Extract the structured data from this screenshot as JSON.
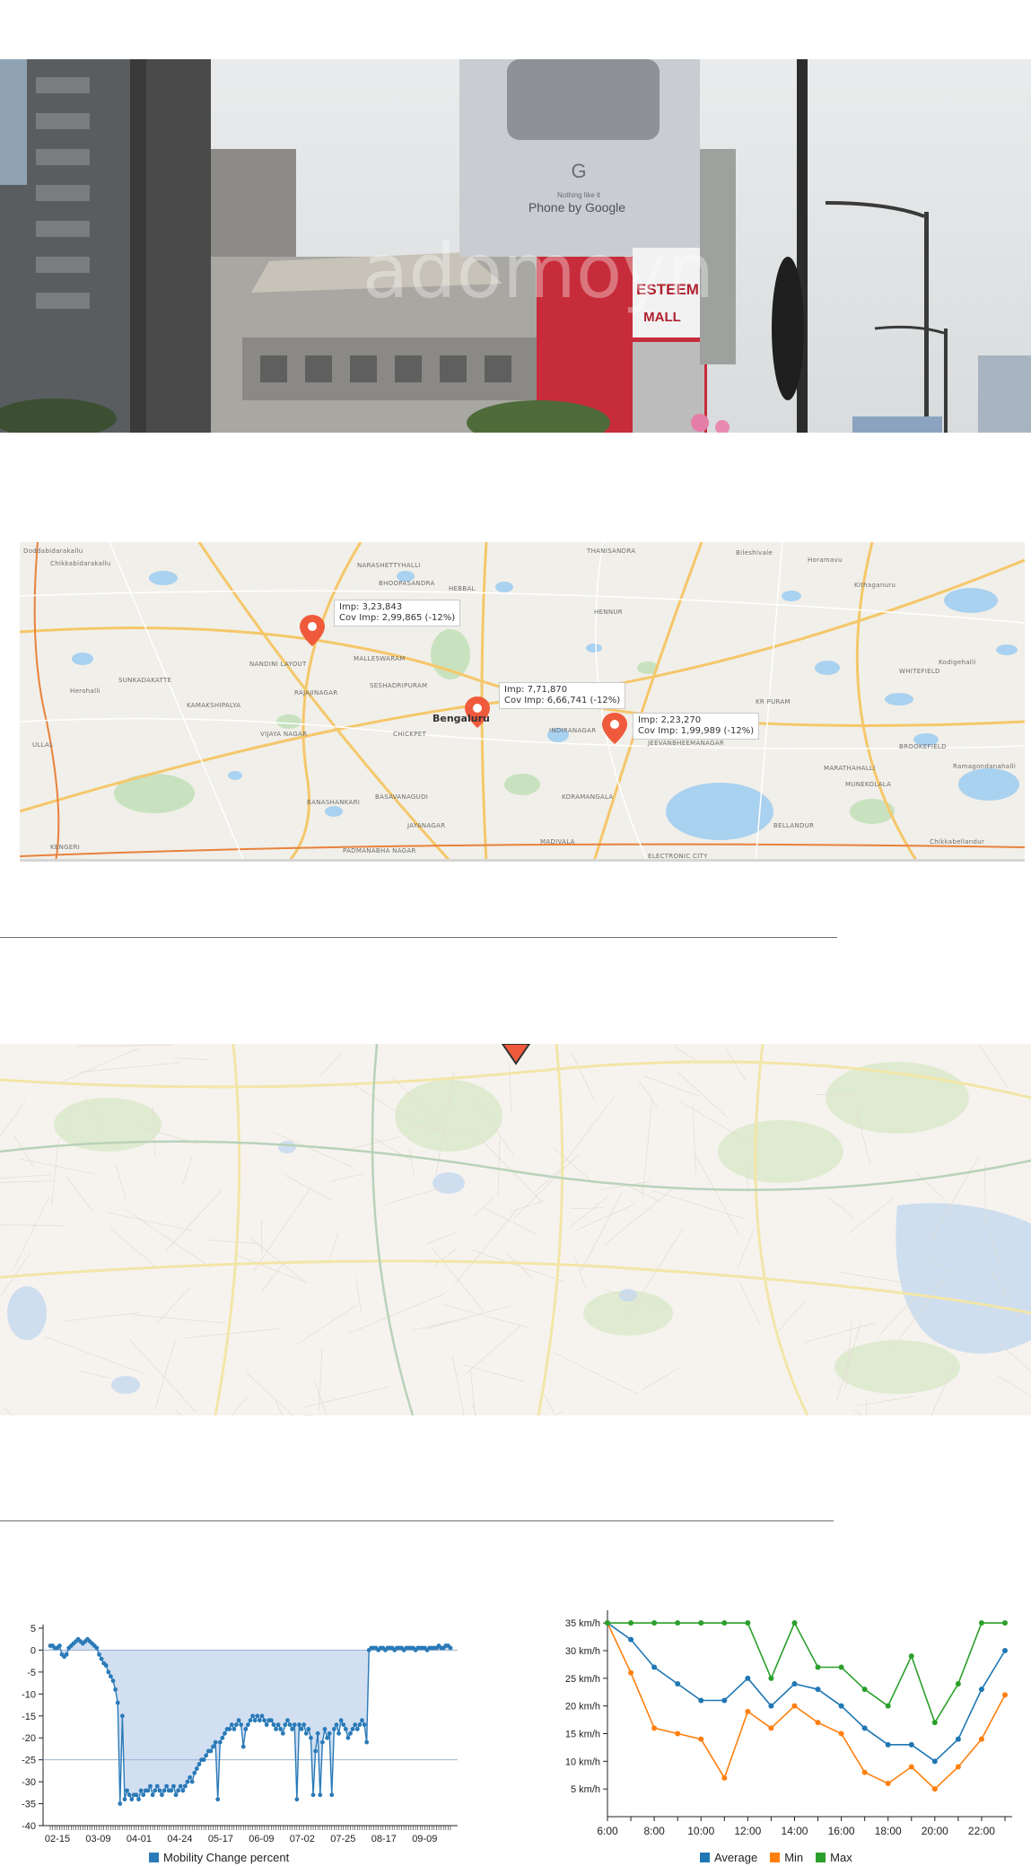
{
  "photo": {
    "billboard_brand": "Phone by Google",
    "billboard_tagline": "Nothing like it",
    "watermark": "adomoyn",
    "mall_sign_line1": "ESTEEM",
    "mall_sign_line2": "MALL"
  },
  "map1": {
    "city_label": "Bengaluru",
    "places": [
      "THANISANDRA",
      "Bileshivale",
      "Doddabidarakallu",
      "Chikkabidarakallu",
      "NARASHETTYHALLI",
      "BHOOPASANDRA",
      "HEBBAL",
      "HENNUR",
      "Horamavu",
      "Kithaganuru",
      "MALLESWARAM",
      "SESHADRIPURAM",
      "VIJAYA NAGAR",
      "CHICKPET",
      "JAYANAGAR",
      "KORAMANGALA",
      "MADIVALA",
      "INDIRANAGAR",
      "JEEVANBHEEMANAGAR",
      "MARATHAHALLI",
      "WHITEFIELD",
      "BROOKEFIELD",
      "KR PURAM",
      "BELLANDUR",
      "BANASHANKARI",
      "PADMANABHA NAGAR",
      "KENGERI",
      "ULLAL",
      "Herohalli",
      "SUNKADAKATTE",
      "NANDINI LAYOUT",
      "KAMAKSHIPALYA",
      "RAJAJINAGAR",
      "BASAVANAGUDI",
      "MUNEKOLALA",
      "Kodigehalli",
      "Ramagondanahalli",
      "Chikkabellandur",
      "ELECTRONIC CITY"
    ],
    "markers": [
      {
        "imp": "Imp: 3,23,843",
        "cov": "Cov Imp: 2,99,865 (-12%)"
      },
      {
        "imp": "Imp: 7,71,870",
        "cov": "Cov Imp: 6,66,741 (-12%)"
      },
      {
        "imp": "Imp: 2,23,270",
        "cov": "Cov Imp: 1,99,989 (-12%)"
      }
    ]
  },
  "charts": {
    "mobility": {
      "partial_title": "",
      "legend_label": "Mobility Change percent",
      "colors": {
        "line": "#2a7ab8",
        "fill": "#c9d9ee",
        "ref": "#9bb3d0"
      }
    },
    "speed": {
      "colors": {
        "Average": "#1f77b4",
        "Min": "#ff7f0e",
        "Max": "#2ca02c"
      }
    }
  },
  "chart_data": [
    {
      "type": "area",
      "title": "",
      "ylim": [
        -40,
        5
      ],
      "yticks": [
        "5",
        "0",
        "-5",
        "-10",
        "-15",
        "-20",
        "-25",
        "-30",
        "-35",
        "-40"
      ],
      "xticks": [
        "02-15",
        "03-09",
        "04-01",
        "04-24",
        "05-17",
        "06-09",
        "07-02",
        "07-25",
        "08-17",
        "09-09"
      ],
      "reference_line": -25,
      "series": [
        {
          "name": "Mobility Change percent",
          "values": [
            1,
            1,
            0.5,
            0.5,
            1,
            -1,
            -1.5,
            -1,
            0.5,
            1,
            1.5,
            2,
            2.5,
            2,
            1.5,
            2,
            2.5,
            2,
            1.5,
            1,
            0.5,
            -1,
            -2,
            -3,
            -3.5,
            -5,
            -6,
            -7,
            -9,
            -12,
            -35,
            -15,
            -34,
            -32,
            -33,
            -34,
            -33,
            -33,
            -34,
            -32,
            -33,
            -32,
            -32,
            -31,
            -33,
            -32,
            -31,
            -32,
            -33,
            -32,
            -31,
            -32,
            -32,
            -31,
            -33,
            -32,
            -31,
            -32,
            -31,
            -30,
            -29,
            -30,
            -28,
            -27,
            -26,
            -25,
            -25,
            -24,
            -23,
            -23,
            -22,
            -21,
            -34,
            -21,
            -20,
            -19,
            -18,
            -18,
            -17,
            -18,
            -17,
            -16,
            -17,
            -22,
            -18,
            -17,
            -16,
            -15,
            -16,
            -15,
            -16,
            -15,
            -16,
            -17,
            -16,
            -16,
            -17,
            -18,
            -17,
            -18,
            -19,
            -17,
            -16,
            -17,
            -18,
            -17,
            -34,
            -17,
            -18,
            -17,
            -19,
            -18,
            -20,
            -33,
            -23,
            -19,
            -33,
            -21,
            -18,
            -20,
            -19,
            -33,
            -18,
            -17,
            -19,
            -16,
            -17,
            -18,
            -20,
            -19,
            -18,
            -17,
            -18,
            -17,
            -16,
            -17,
            -21,
            0,
            0.5,
            0.5,
            0.5,
            0,
            0.5,
            0.5,
            0,
            0.5,
            0.5,
            0.5,
            0,
            0.5,
            0.5,
            0.5,
            0,
            0.5,
            0.5,
            0.5,
            0.5,
            0,
            0.5,
            0.5,
            0.5,
            0.5,
            0,
            0.5,
            0.5,
            0.5,
            0.5,
            1,
            0.5,
            0.5,
            1,
            1,
            0.5
          ]
        }
      ]
    },
    {
      "type": "line",
      "ylim": [
        0,
        36
      ],
      "yticks": [
        "5 km/h",
        "10 km/h",
        "15 km/h",
        "20 km/h",
        "25 km/h",
        "30 km/h",
        "35 km/h"
      ],
      "xticks": [
        "6:00",
        "8:00",
        "10:00",
        "12:00",
        "14:00",
        "16:00",
        "18:00",
        "20:00",
        "22:00"
      ],
      "x": [
        6,
        7,
        8,
        9,
        10,
        11,
        12,
        13,
        14,
        15,
        16,
        17,
        18,
        19,
        20,
        21,
        22,
        23
      ],
      "series": [
        {
          "name": "Average",
          "values": [
            35,
            32,
            27,
            24,
            21,
            21,
            25,
            20,
            24,
            23,
            20,
            16,
            13,
            13,
            10,
            14,
            23,
            30
          ]
        },
        {
          "name": "Min",
          "values": [
            35,
            26,
            16,
            15,
            14,
            7,
            19,
            16,
            20,
            17,
            15,
            8,
            6,
            9,
            5,
            9,
            14,
            22
          ]
        },
        {
          "name": "Max",
          "values": [
            35,
            35,
            35,
            35,
            35,
            35,
            35,
            25,
            35,
            27,
            27,
            23,
            20,
            29,
            17,
            24,
            35,
            35
          ]
        }
      ]
    }
  ]
}
